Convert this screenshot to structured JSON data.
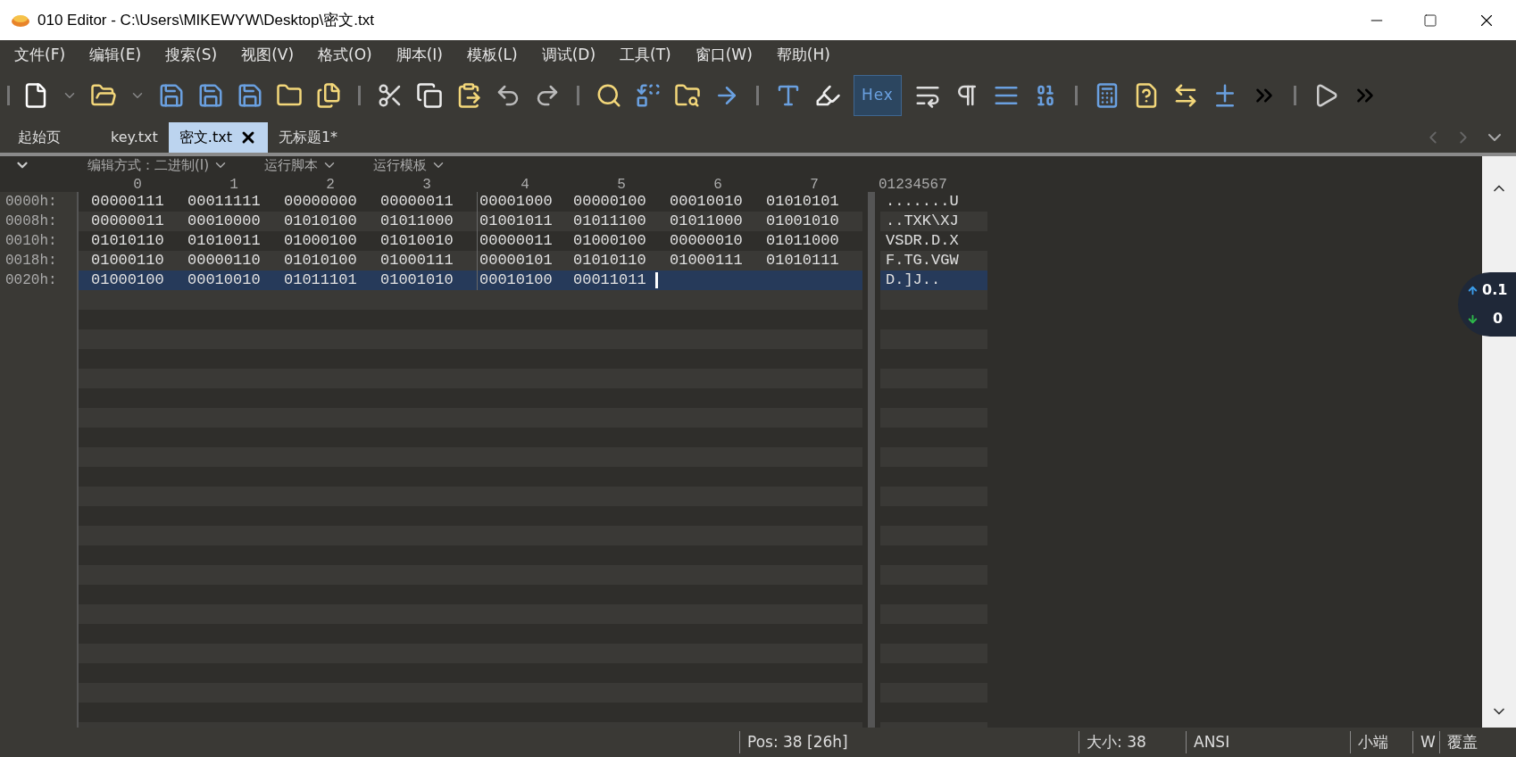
{
  "window": {
    "title": "010 Editor - C:\\Users\\MIKEWYW\\Desktop\\密文.txt"
  },
  "menu": [
    "文件(F)",
    "编辑(E)",
    "搜索(S)",
    "视图(V)",
    "格式(O)",
    "脚本(I)",
    "模板(L)",
    "调试(D)",
    "工具(T)",
    "窗口(W)",
    "帮助(H)"
  ],
  "toolbar": {
    "hex_button": {
      "label": "Hex",
      "selected": true
    }
  },
  "tabs": [
    {
      "label": "起始页",
      "selected": false,
      "closable": false
    },
    {
      "label": "key.txt",
      "selected": false,
      "closable": false
    },
    {
      "label": "密文.txt",
      "selected": true,
      "closable": true
    },
    {
      "label": "无标题1*",
      "selected": false,
      "closable": false
    }
  ],
  "editor_bar": [
    "编辑方式：二进制(I)",
    "运行脚本",
    "运行模板"
  ],
  "column_header": {
    "hex": [
      "0",
      "1",
      "2",
      "3",
      "4",
      "5",
      "6",
      "7"
    ],
    "text": "01234567"
  },
  "rows": [
    {
      "address": "0000h:",
      "bytes": [
        "00000111",
        "00011111",
        "00000000",
        "00000011",
        "00001000",
        "00000100",
        "00010010",
        "01010101"
      ],
      "text": ".......U",
      "selected": false
    },
    {
      "address": "0008h:",
      "bytes": [
        "00000011",
        "00010000",
        "01010100",
        "01011000",
        "01001011",
        "01011100",
        "01011000",
        "01001010"
      ],
      "text": "..TXK\\XJ",
      "selected": false
    },
    {
      "address": "0010h:",
      "bytes": [
        "01010110",
        "01010011",
        "01000100",
        "01010010",
        "00000011",
        "01000100",
        "00000010",
        "01011000"
      ],
      "text": "VSDR.D.X",
      "selected": false
    },
    {
      "address": "0018h:",
      "bytes": [
        "01000110",
        "00000110",
        "01010100",
        "01000111",
        "00000101",
        "01010110",
        "01000111",
        "01010111"
      ],
      "text": "F.TG.VGW",
      "selected": false
    },
    {
      "address": "0020h:",
      "bytes": [
        "01000100",
        "00010010",
        "01011101",
        "01001010",
        "00010100",
        "00011011"
      ],
      "text": "D.]J..",
      "selected": true
    }
  ],
  "status_bar": [
    "Pos: 38 [26h]",
    "大小: 38",
    "ANSI",
    "小端",
    "W",
    "覆盖"
  ],
  "network_widget": {
    "up": "0.1",
    "down": "0"
  }
}
